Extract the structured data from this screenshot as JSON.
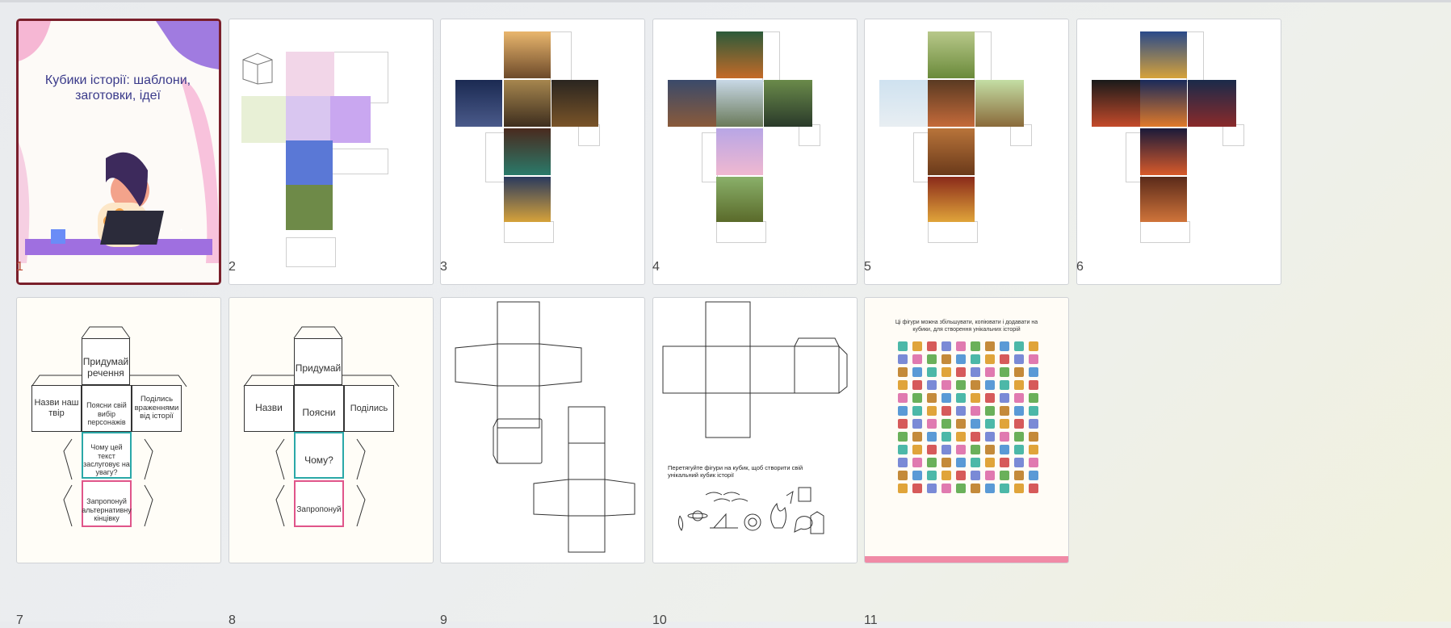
{
  "slides": [
    {
      "number": "1",
      "title": "Кубики історії: шаблони, заготовки, ідеї",
      "selected": true
    },
    {
      "number": "2"
    },
    {
      "number": "3"
    },
    {
      "number": "4"
    },
    {
      "number": "5"
    },
    {
      "number": "6"
    },
    {
      "number": "7",
      "faces": [
        "Придумай речення",
        "Назви наш твір",
        "Поясни свій вибір персонажів",
        "Поділись враженнями від історії",
        "Чому цей текст заслуговує на увагу?",
        "Запропонуй альтернативну кінцівку"
      ]
    },
    {
      "number": "8",
      "faces": [
        "Придумай",
        "Назви",
        "Поясни",
        "Поділись",
        "Чому?",
        "Запропонуй"
      ]
    },
    {
      "number": "9"
    },
    {
      "number": "10",
      "caption": "Перетягуйте фігури на кубик, щоб створити свій унікальний кубик історії"
    },
    {
      "number": "11",
      "caption": "Ці фігури можна збільшувати, копіювати і додавати на кубики, для створення унікальних історій"
    }
  ],
  "colors": {
    "accent": "#7a1f2b",
    "number_selected": "#b8442f",
    "purple": "#8b5cf6",
    "pink": "#f49ac1"
  }
}
